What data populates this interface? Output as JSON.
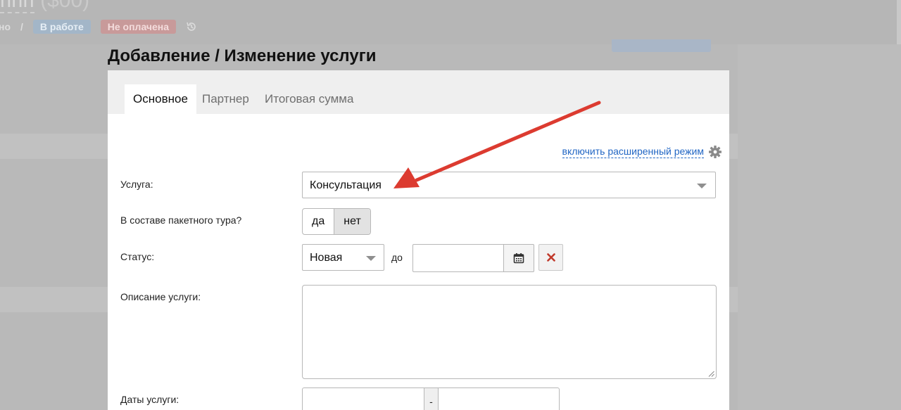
{
  "background": {
    "title_word": "ппп",
    "title_num": "($00)",
    "crumb_prefix": "но",
    "crumb_sep": "/",
    "badge_in_work": "В работе",
    "badge_unpaid": "Не оплачена"
  },
  "modal": {
    "title": "Добавление / Изменение услуги",
    "tabs": [
      {
        "label": "Основное",
        "active": true
      },
      {
        "label": "Партнер",
        "active": false
      },
      {
        "label": "Итоговая сумма",
        "active": false
      }
    ],
    "advanced_link": "включить расширенный режим",
    "fields": {
      "service_label": "Услуга:",
      "service_value": "Консультация",
      "package_label": "В составе пакетного тура?",
      "package_yes": "да",
      "package_no": "нет",
      "package_selected": "нет",
      "status_label": "Статус:",
      "status_value": "Новая",
      "until_label": "до",
      "description_label": "Описание услуги:",
      "dates_label": "Даты услуги:",
      "dates_separator": "-"
    }
  },
  "colors": {
    "link": "#2166c4",
    "arrow": "#dc3b30",
    "clear_icon": "#c0392b"
  },
  "icons": [
    "gear-icon",
    "calendar-icon",
    "clear-icon",
    "chevron-down-icon",
    "history-icon"
  ]
}
